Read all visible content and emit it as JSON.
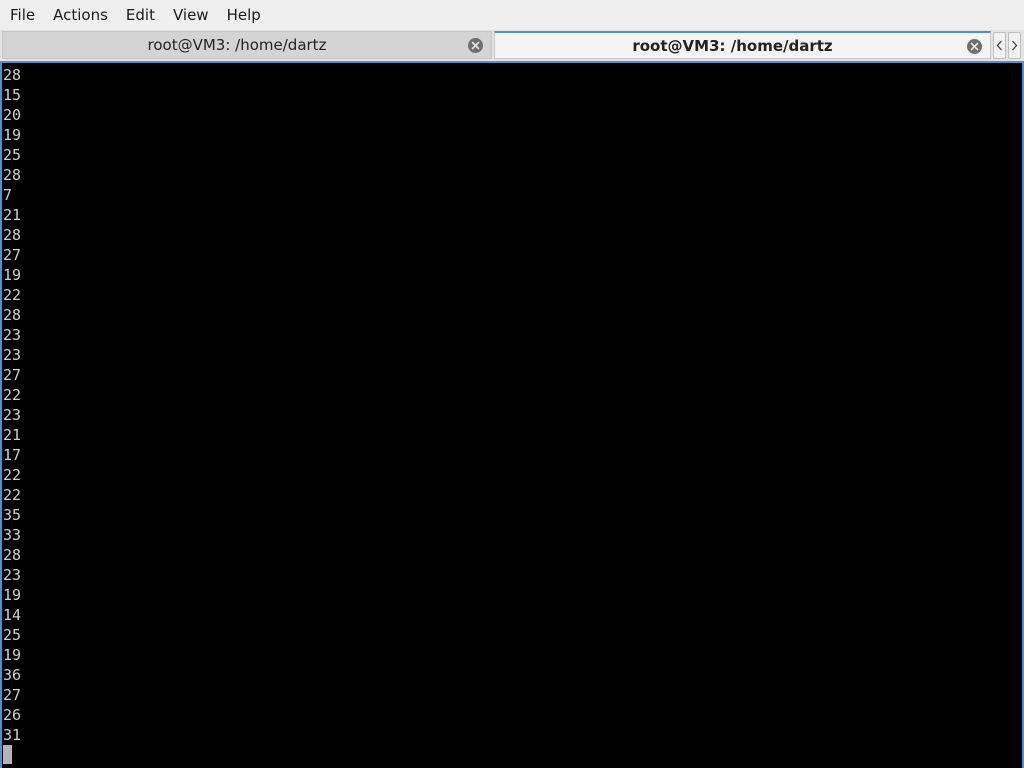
{
  "menubar": {
    "items": [
      "File",
      "Actions",
      "Edit",
      "View",
      "Help"
    ]
  },
  "tabs": [
    {
      "label": "root@VM3: /home/dartz",
      "active": false
    },
    {
      "label": "root@VM3: /home/dartz",
      "active": true
    }
  ],
  "icons": {
    "tab_close": "close-icon",
    "scroll_left": "chevron-left-icon",
    "scroll_right": "chevron-right-icon"
  },
  "colors": {
    "terminal_bg": "#000000",
    "terminal_fg": "#cfcfcf",
    "active_tab_accent": "#4f8fd6"
  },
  "terminal": {
    "lines": [
      "28",
      "15",
      "20",
      "19",
      "25",
      "28",
      "7",
      "21",
      "28",
      "27",
      "19",
      "22",
      "28",
      "23",
      "23",
      "27",
      "22",
      "23",
      "21",
      "17",
      "22",
      "22",
      "35",
      "33",
      "28",
      "23",
      "19",
      "14",
      "25",
      "19",
      "36",
      "27",
      "26",
      "31"
    ]
  }
}
